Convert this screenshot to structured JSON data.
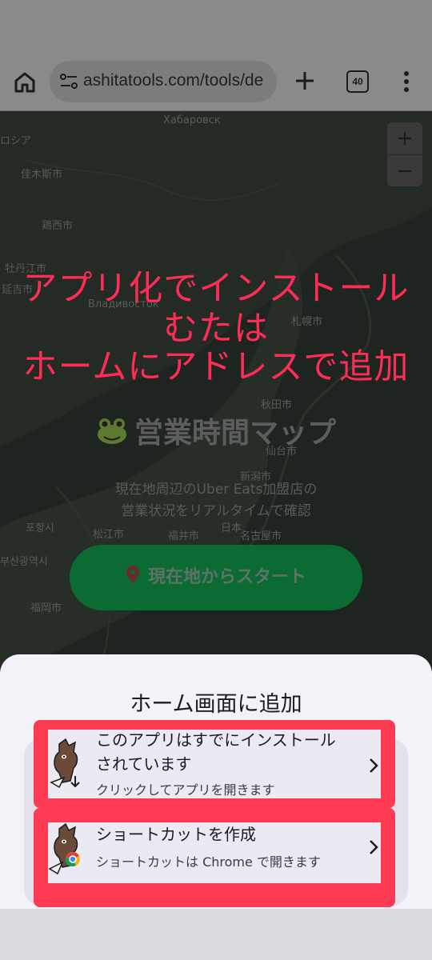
{
  "browser": {
    "url": "ashitatools.com/tools/de",
    "tab_count": "40"
  },
  "map": {
    "zoom_in": "+",
    "zoom_out": "−",
    "places": [
      "ロシア",
      "Хабаровск",
      "佳木斯市",
      "鶏西市",
      "牡丹江市",
      "延吉市",
      "Владивосток",
      "札幌市",
      "秋田市",
      "仙台市",
      "新潟市",
      "日本",
      "松江市",
      "福井市",
      "名古屋市",
      "포항시",
      "부산광역시",
      "福岡市"
    ]
  },
  "annotation": {
    "line1": "アプリ化でインストール",
    "line2": "むたは",
    "line3": "ホームにアドレスで追加"
  },
  "page": {
    "title": "営業時間マップ",
    "subtitle_line1": "現在地周辺のUber Eats加盟店の",
    "subtitle_line2": "営業状況をリアルタイムで確認",
    "start_button": "現在地からスタート"
  },
  "sheet": {
    "title": "ホーム画面に追加",
    "options": [
      {
        "title_line1": "このアプリはすでにインストール",
        "title_line2": "されています",
        "subtitle": "クリックしてアプリを開きます"
      },
      {
        "title_line1": "ショートカットを作成",
        "subtitle": "ショートカットは Chrome で開きます"
      }
    ]
  },
  "colors": {
    "highlight": "#ff3b53",
    "annotation": "#ff2d55",
    "start_button": "#0b6b33"
  }
}
